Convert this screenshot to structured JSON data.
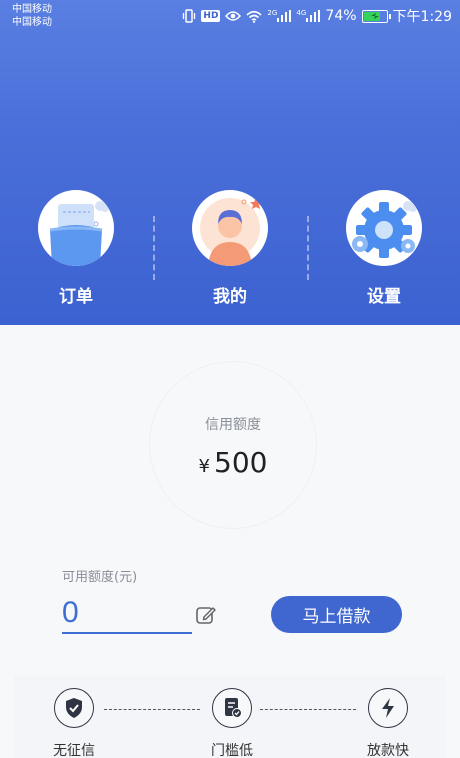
{
  "status_bar": {
    "carrier_1": "中国移动",
    "carrier_2": "中国移动",
    "hd": "HD",
    "net_1": "2G",
    "net_2": "4G",
    "battery_percent": "74%",
    "battery_level": 0.74,
    "time": "下午1:29"
  },
  "nav": {
    "orders_label": "订单",
    "mine_label": "我的",
    "settings_label": "设置"
  },
  "credit": {
    "label": "信用额度",
    "currency": "¥",
    "amount": "500"
  },
  "available": {
    "label": "可用额度(元)",
    "value": "0"
  },
  "borrow_button": "马上借款",
  "features": {
    "no_credit_check": "无征信",
    "low_threshold": "门槛低",
    "fast_payout": "放款快"
  },
  "colors": {
    "header": "#4a6fd9",
    "accent": "#4067cf",
    "input_accent": "#3c6fd4"
  }
}
